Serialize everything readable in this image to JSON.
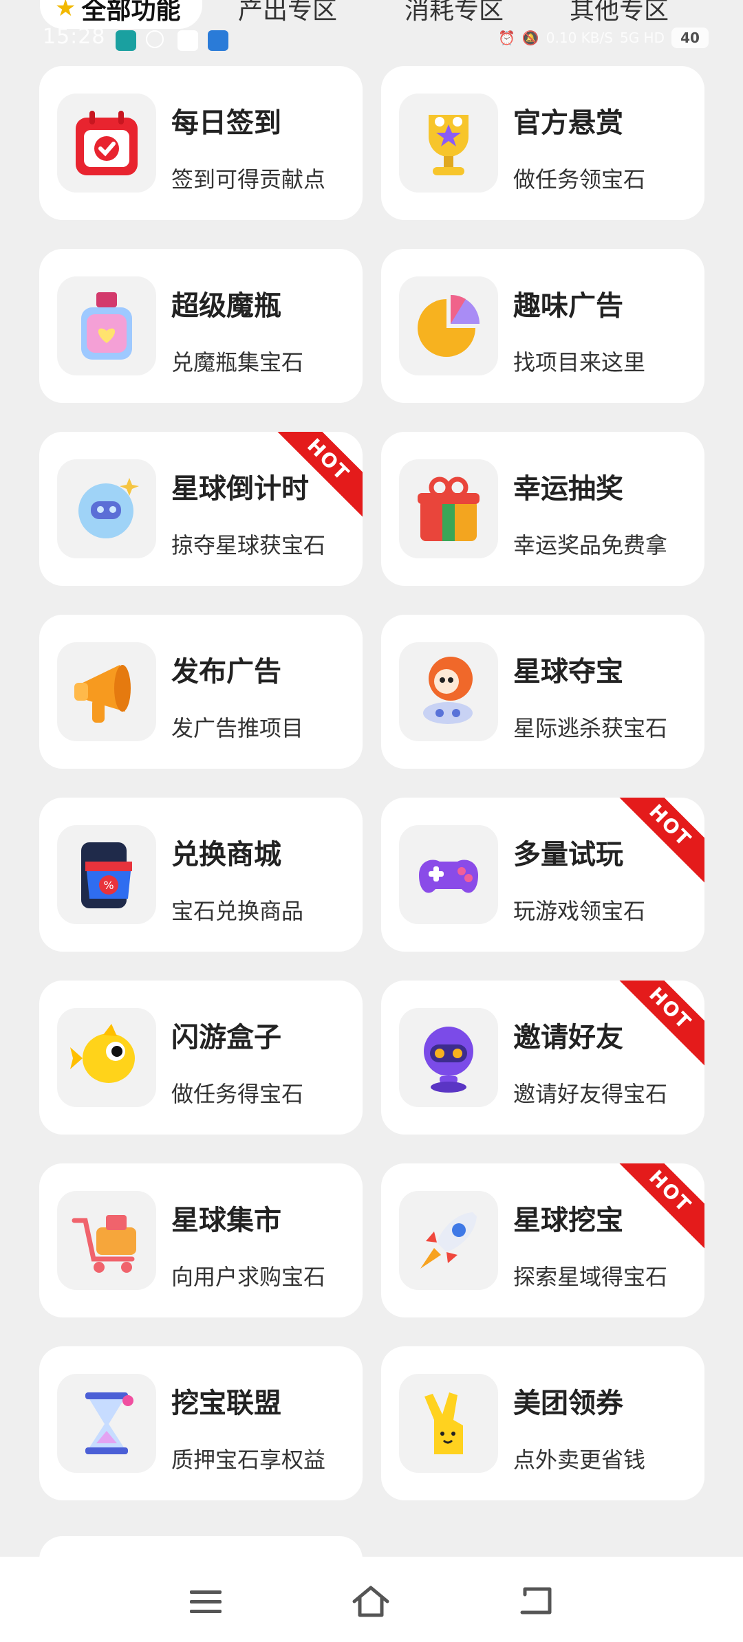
{
  "tabs": [
    {
      "label": "全部功能",
      "active": true
    },
    {
      "label": "产出专区"
    },
    {
      "label": "消耗专区"
    },
    {
      "label": "其他专区"
    }
  ],
  "status": {
    "time": "15:28",
    "speed": "0.10\nKB/S",
    "network": "5G HD",
    "battery": "40"
  },
  "items": [
    {
      "title": "每日签到",
      "sub": "签到可得贡献点",
      "icon": "calendar-icon",
      "hot": false
    },
    {
      "title": "官方悬赏",
      "sub": "做任务领宝石",
      "icon": "trophy-icon",
      "hot": false
    },
    {
      "title": "超级魔瓶",
      "sub": "兑魔瓶集宝石",
      "icon": "bottle-icon",
      "hot": false
    },
    {
      "title": "趣味广告",
      "sub": "找项目来这里",
      "icon": "pie-icon",
      "hot": false
    },
    {
      "title": "星球倒计时",
      "sub": "掠夺星球获宝石",
      "icon": "planet-icon",
      "hot": true
    },
    {
      "title": "幸运抽奖",
      "sub": "幸运奖品免费拿",
      "icon": "gift-icon",
      "hot": false
    },
    {
      "title": "发布广告",
      "sub": "发广告推项目",
      "icon": "megaphone-icon",
      "hot": false
    },
    {
      "title": "星球夺宝",
      "sub": "星际逃杀获宝石",
      "icon": "astronaut-icon",
      "hot": false
    },
    {
      "title": "兑换商城",
      "sub": "宝石兑换商品",
      "icon": "shop-icon",
      "hot": false
    },
    {
      "title": "多量试玩",
      "sub": "玩游戏领宝石",
      "icon": "gamepad-icon",
      "hot": true
    },
    {
      "title": "闪游盒子",
      "sub": "做任务得宝石",
      "icon": "fish-icon",
      "hot": false
    },
    {
      "title": "邀请好友",
      "sub": "邀请好友得宝石",
      "icon": "robot-icon",
      "hot": true
    },
    {
      "title": "星球集市",
      "sub": "向用户求购宝石",
      "icon": "cart-icon",
      "hot": false
    },
    {
      "title": "星球挖宝",
      "sub": "探索星域得宝石",
      "icon": "rocket-icon",
      "hot": true
    },
    {
      "title": "挖宝联盟",
      "sub": "质押宝石享权益",
      "icon": "hourglass-icon",
      "hot": false
    },
    {
      "title": "美团领券",
      "sub": "点外卖更省钱",
      "icon": "meituan-hand-icon",
      "hot": false
    }
  ],
  "hot_label": "HOT",
  "colors": {
    "background": "#efefef",
    "card": "#ffffff",
    "hot": "#e41b1b"
  }
}
